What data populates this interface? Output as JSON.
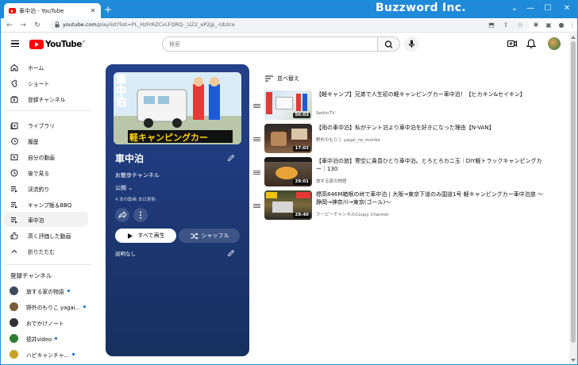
{
  "browser": {
    "tab_title": "車中泊 - YouTube",
    "new_tab": "+",
    "brand": "Buzzword Inc.",
    "url_host": "youtube.com",
    "url_rest": "/playlist?list=PL_HzFrRZCvLFQRQ-_UZ2_eP2jp_-Ubzce"
  },
  "header": {
    "logo": "YouTube",
    "logo_region": "JP",
    "search_placeholder": "検索"
  },
  "sidebar": {
    "main": [
      {
        "label": "ホーム",
        "icon": "home-icon"
      },
      {
        "label": "ショート",
        "icon": "shorts-icon"
      },
      {
        "label": "登録チャンネル",
        "icon": "subscriptions-icon"
      }
    ],
    "you": [
      {
        "label": "ライブラリ",
        "icon": "library-icon"
      },
      {
        "label": "履歴",
        "icon": "history-icon"
      },
      {
        "label": "自分の動画",
        "icon": "your-videos-icon"
      },
      {
        "label": "後で見る",
        "icon": "watch-later-icon"
      },
      {
        "label": "渓流釣り",
        "icon": "playlist-icon"
      },
      {
        "label": "キャンプ飯＆BBQ",
        "icon": "playlist-icon"
      },
      {
        "label": "車中泊",
        "icon": "playlist-icon"
      },
      {
        "label": "高く評価した動画",
        "icon": "liked-icon"
      },
      {
        "label": "折りたたむ",
        "icon": "collapse-icon"
      }
    ],
    "subs_heading": "登録チャンネル",
    "subscriptions": [
      {
        "label": "旅する家の物語",
        "dot": true,
        "color": "#3b4b5c"
      },
      {
        "label": "野外のもりこ yagai...",
        "dot": true,
        "color": "#7a5c3a"
      },
      {
        "label": "おでかけノート",
        "dot": false,
        "color": "#333333"
      },
      {
        "label": "德井video",
        "dot": true,
        "color": "#2e7d32"
      },
      {
        "label": "ハピキャンチャ...",
        "dot": true,
        "color": "#c9a227"
      }
    ]
  },
  "playlist": {
    "title": "車中泊",
    "channel": "お散歩チャンネル",
    "visibility": "公開",
    "meta": "4 本の動画  本日更新",
    "play_all": "すべて再生",
    "shuffle": "シャッフル",
    "description": "説明なし",
    "thumb_text_top": "車中泊",
    "thumb_text_bottom": "軽キャンピングカー"
  },
  "list": {
    "sort_label": "並べ替え",
    "videos": [
      {
        "title": "【軽キャンプ】兄弟で人生初の軽キャンピングカー車中泊！【ヒカキン&セイキン】",
        "channel": "SeikinTV",
        "duration": "56:03"
      },
      {
        "title": "【雨の車中泊】私がテント泊より車中泊を好きになった理由【N-VAN】",
        "channel": "野外のもりこ yagai_no_moriko",
        "duration": "17:03"
      },
      {
        "title": "【車中泊の旅】寒空に貴昏ひとり車中泊。とろとろカニ玉｜DIY軽トラックキャンピングカー｜130",
        "channel": "旅する家の物語",
        "duration": "29:01"
      },
      {
        "title": "標高846M箱根の峠で車中泊 | 大阪→東京下道のみ国道1号 軽キャンピングカー車中泊旅 ～静岡→神奈川→東京(ゴール)～",
        "channel": "クーピーチャンネルCoupy Channel",
        "duration": "29:40"
      }
    ]
  },
  "colors": {
    "titlebar": "#1f8ad8",
    "youtube_red": "#ff0000",
    "panel": "#1f3a7a"
  }
}
